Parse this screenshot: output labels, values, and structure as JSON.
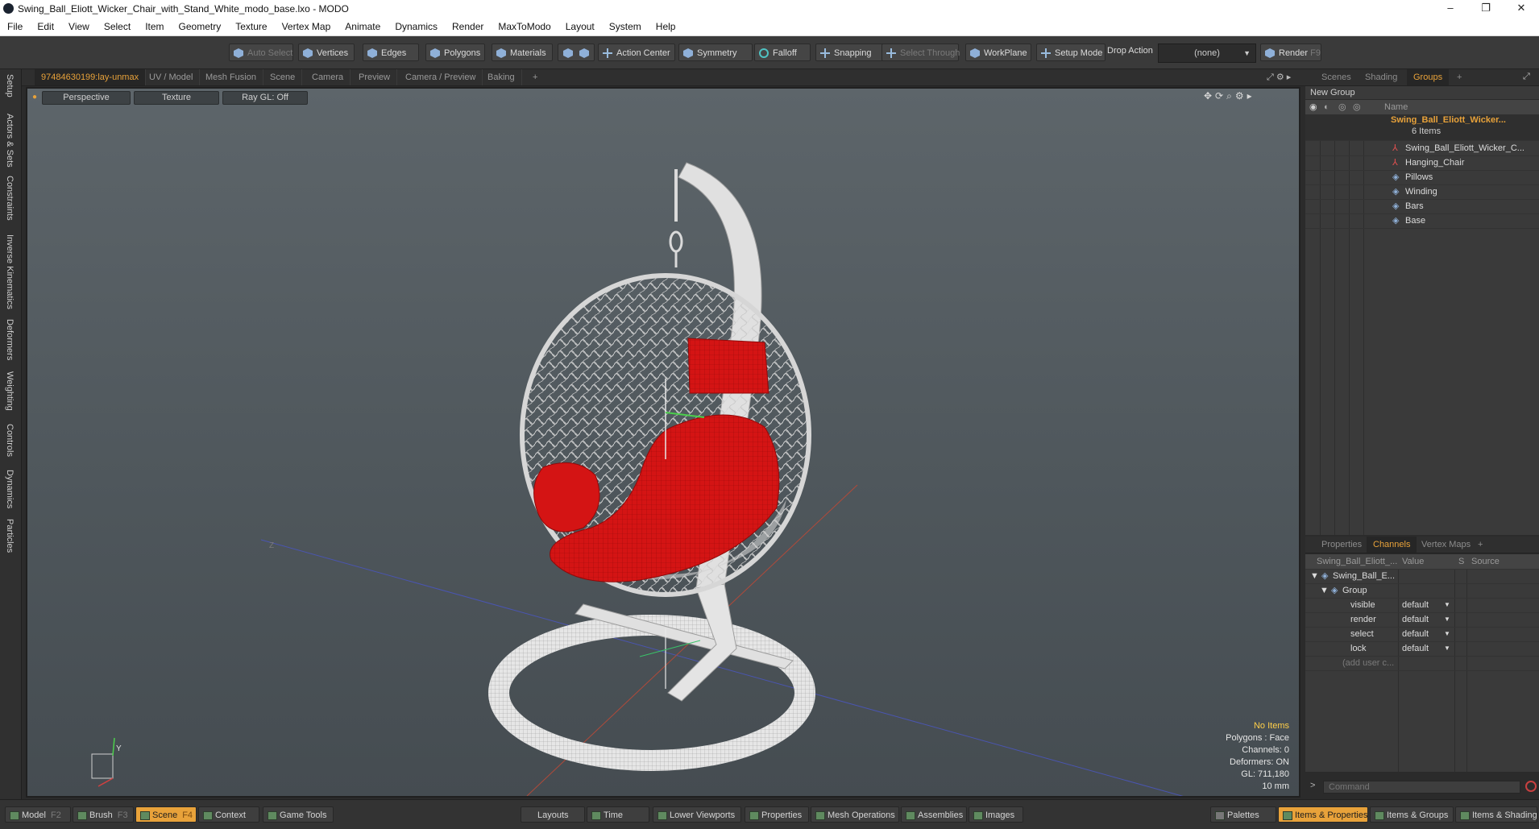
{
  "window": {
    "title": "Swing_Ball_Eliott_Wicker_Chair_with_Stand_White_modo_base.lxo - MODO",
    "controls": [
      "–",
      "❐",
      "✕"
    ]
  },
  "menu": [
    "File",
    "Edit",
    "View",
    "Select",
    "Item",
    "Geometry",
    "Texture",
    "Vertex Map",
    "Animate",
    "Dynamics",
    "Render",
    "MaxToModo",
    "Layout",
    "System",
    "Help"
  ],
  "toolbar": {
    "auto_select": "Auto Select",
    "vertices": "Vertices",
    "edges": "Edges",
    "polygons": "Polygons",
    "materials": "Materials",
    "action_center": "Action Center",
    "symmetry": "Symmetry",
    "falloff": "Falloff",
    "snapping": "Snapping",
    "select_through": "Select Through",
    "workplane": "WorkPlane",
    "setup_mode": "Setup Mode",
    "drop_action": "Drop Action",
    "drop_value": "(none)",
    "render": "Render",
    "render_key": "F9"
  },
  "left_tabs": [
    "Setup",
    "Actors & Sets",
    "Constraints",
    "Inverse Kinematics",
    "Deformers",
    "Weighting",
    "Controls",
    "Dynamics",
    "Particles"
  ],
  "viewport_tabs": [
    "97484630199:lay-unmax",
    "UV / Model",
    "Mesh Fusion",
    "Scene",
    "Camera",
    "Preview",
    "Camera / Preview",
    "Baking",
    "+"
  ],
  "viewport": {
    "view_mode": "Perspective",
    "shading": "Texture",
    "raygl": "Ray GL: Off",
    "info": {
      "selection": "No Items",
      "polygons": "Polygons : Face",
      "channels": "Channels: 0",
      "deformers": "Deformers: ON",
      "gl": "GL: 711,180",
      "scale": "10 mm"
    },
    "axis_y": "Y",
    "axis_z": "Z"
  },
  "scene_tabs": [
    "Scenes",
    "Shading",
    "Groups",
    "+"
  ],
  "groups": {
    "new_group": "New Group",
    "name_header": "Name",
    "root": {
      "name": "Swing_Ball_Eliott_Wicker...",
      "count": "6 Items"
    },
    "items": [
      "Swing_Ball_Eliott_Wicker_C...",
      "Hanging_Chair",
      "Pillows",
      "Winding",
      "Bars",
      "Base"
    ]
  },
  "prop_tabs": [
    "Properties",
    "Channels",
    "Vertex Maps",
    "+"
  ],
  "channels": {
    "headers": [
      "Swing_Ball_Eliott_...",
      "Value",
      "S",
      "Source"
    ],
    "tree": [
      "Swing_Ball_E...",
      "Group"
    ],
    "rows": [
      {
        "name": "visible",
        "value": "default"
      },
      {
        "name": "render",
        "value": "default"
      },
      {
        "name": "select",
        "value": "default"
      },
      {
        "name": "lock",
        "value": "default"
      }
    ],
    "add_user": "(add user c..."
  },
  "command": {
    "prompt": ">",
    "placeholder": "Command"
  },
  "bottom": {
    "left": [
      {
        "label": "Model",
        "key": "F2"
      },
      {
        "label": "Brush",
        "key": "F3"
      },
      {
        "label": "Scene",
        "key": "F4"
      },
      {
        "label": "Context",
        "key": ""
      },
      {
        "label": "Game Tools",
        "key": ""
      }
    ],
    "center": [
      "Layouts",
      "Time",
      "Lower Viewports",
      "Properties",
      "Mesh Operations",
      "Assemblies",
      "Images"
    ],
    "right": [
      "Palettes",
      "Items & Properties",
      "Items & Groups",
      "Items & Shading"
    ]
  },
  "colors": {
    "accent": "#e8a23a",
    "cushion": "#d41414",
    "wicker": "#d8d8d8"
  }
}
